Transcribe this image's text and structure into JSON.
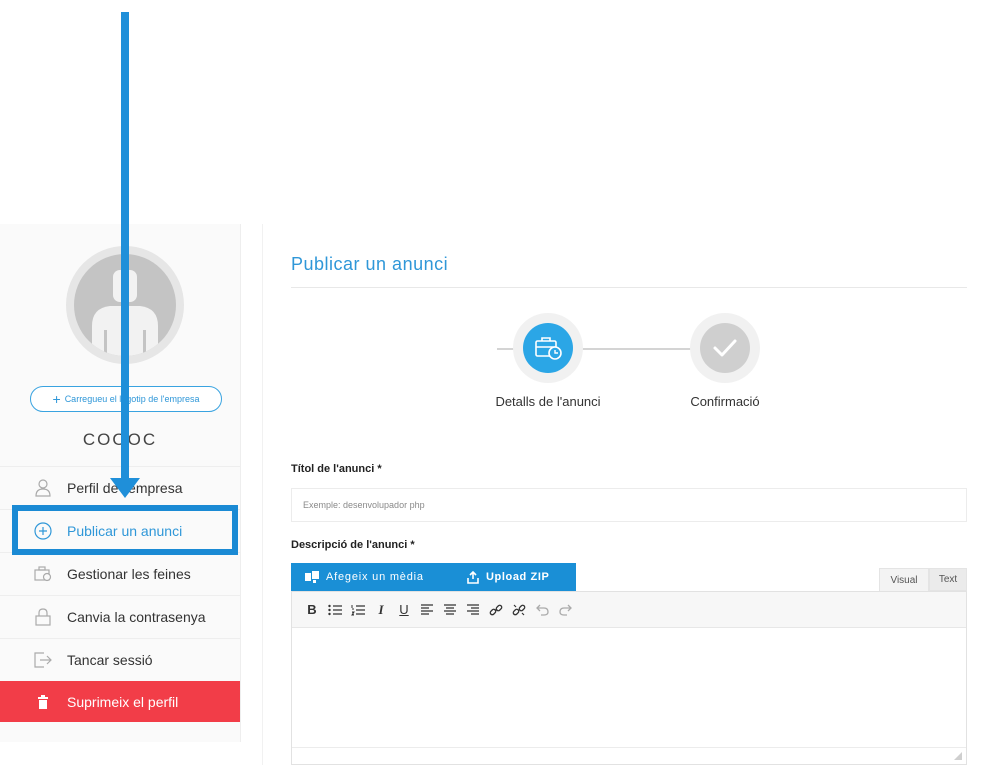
{
  "sidebar": {
    "upload_logo_label": "Carregueu el logotip de l'empresa",
    "company_name": "COOOC",
    "items": [
      {
        "label": "Perfil de l'empresa",
        "icon": "user-icon"
      },
      {
        "label": "Publicar un anunci",
        "icon": "plus-circle-icon",
        "active": true
      },
      {
        "label": "Gestionar les feines",
        "icon": "briefcase-clock-icon"
      },
      {
        "label": "Canvia la contrasenya",
        "icon": "lock-icon"
      },
      {
        "label": "Tancar sessió",
        "icon": "logout-icon"
      },
      {
        "label": "Suprimeix el perfil",
        "icon": "trash-icon",
        "danger": true
      }
    ]
  },
  "main": {
    "title": "Publicar un anunci",
    "steps": [
      {
        "label": "Detalls de l'anunci",
        "icon": "briefcase-icon",
        "state": "active"
      },
      {
        "label": "Confirmació",
        "icon": "check-icon",
        "state": "pending"
      }
    ],
    "ad_title_label": "Títol de l'anunci *",
    "ad_title_placeholder": "Exemple: desenvolupador php",
    "description_label": "Descripció de l'anunci *",
    "add_media_label": "Afegeix un mèdia",
    "upload_zip_label": "Upload ZIP",
    "tab_visual": "Visual",
    "tab_text": "Text",
    "toolbar_bold": "B",
    "toolbar_italic": "I",
    "toolbar_underline": "U"
  },
  "colors": {
    "accent": "#2f97d8",
    "annotation_arrow": "#1f8fd9",
    "danger": "#f23d48",
    "step_active": "#2ba6e6",
    "step_pending": "#cfcfcf"
  }
}
